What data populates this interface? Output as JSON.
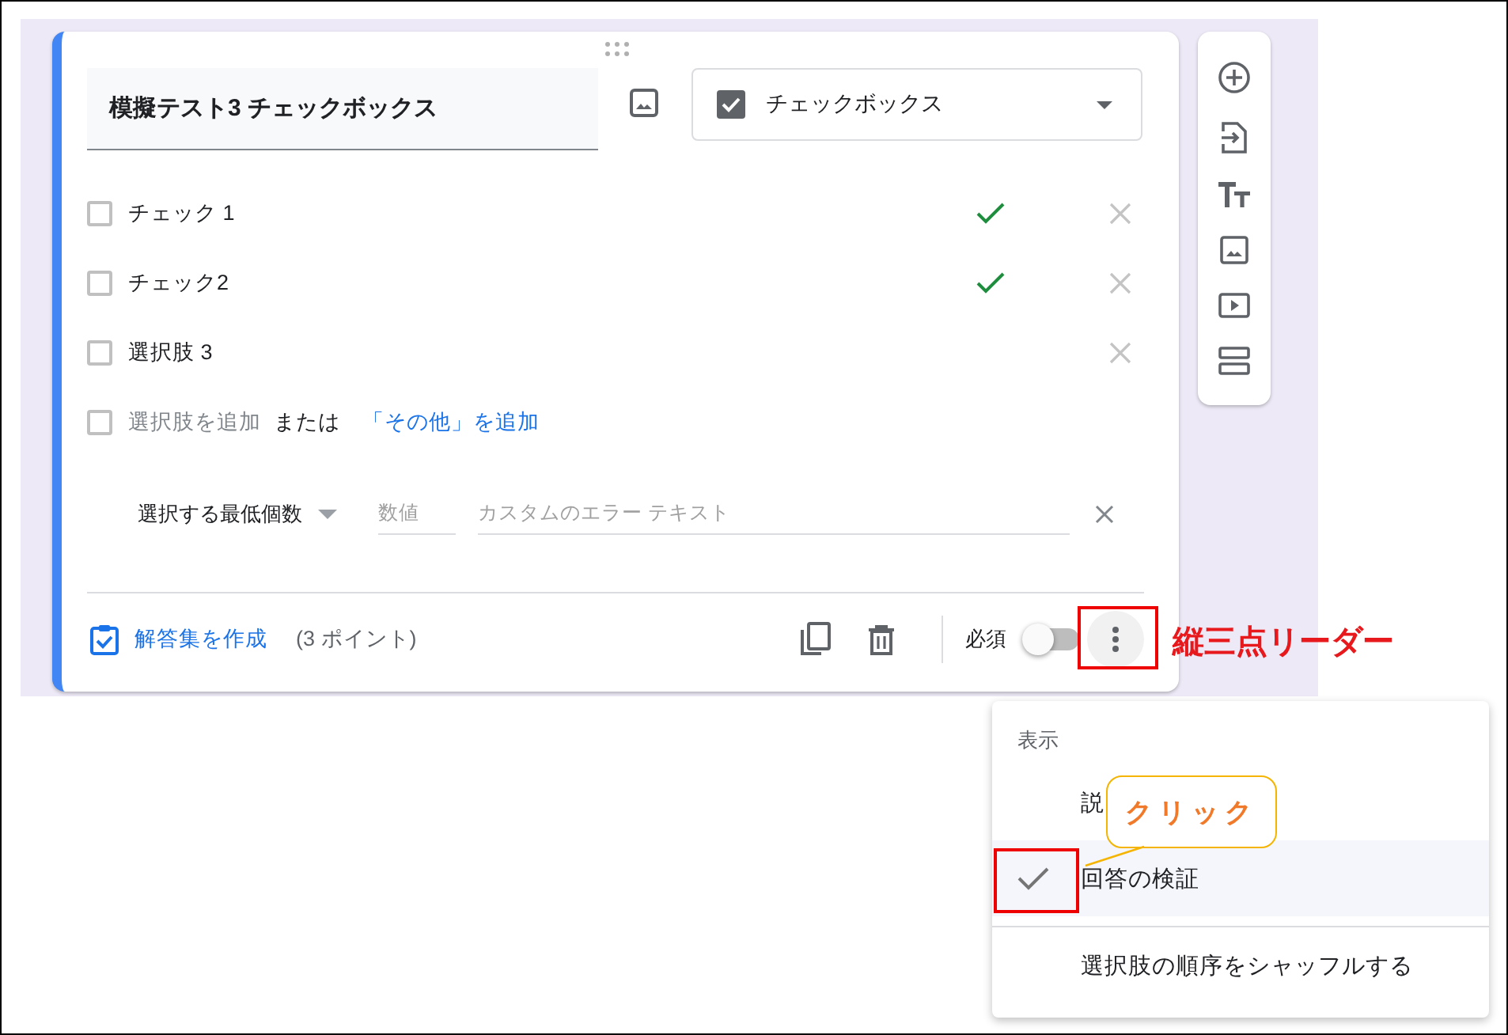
{
  "question": {
    "title": "模擬テスト3 チェックボックス",
    "type_label": "チェックボックス",
    "options": [
      {
        "label": "チェック 1",
        "correct": true,
        "checked": false
      },
      {
        "label": "チェック2",
        "correct": true,
        "checked": false
      },
      {
        "label": "選択肢 3",
        "correct": false,
        "checked": false
      }
    ],
    "add_option": {
      "checked": false,
      "placeholder": "選択肢を追加",
      "or_text": "または",
      "add_other": "「その他」を追加"
    },
    "validation": {
      "rule": "選択する最低個数",
      "number_placeholder": "数値",
      "error_placeholder": "カスタムのエラー テキスト"
    },
    "footer": {
      "answer_key": "解答集を作成",
      "points": "(3 ポイント)",
      "required_label": "必須",
      "required": false
    }
  },
  "menu": {
    "header": "表示",
    "items": [
      {
        "label": "説",
        "checked": false
      },
      {
        "label": "回答の検証",
        "checked": true
      },
      {
        "label": "選択肢の順序をシャッフルする",
        "checked": false
      }
    ]
  },
  "annotations": {
    "leader_label": "縦三点リーダー",
    "callout": "クリック"
  }
}
